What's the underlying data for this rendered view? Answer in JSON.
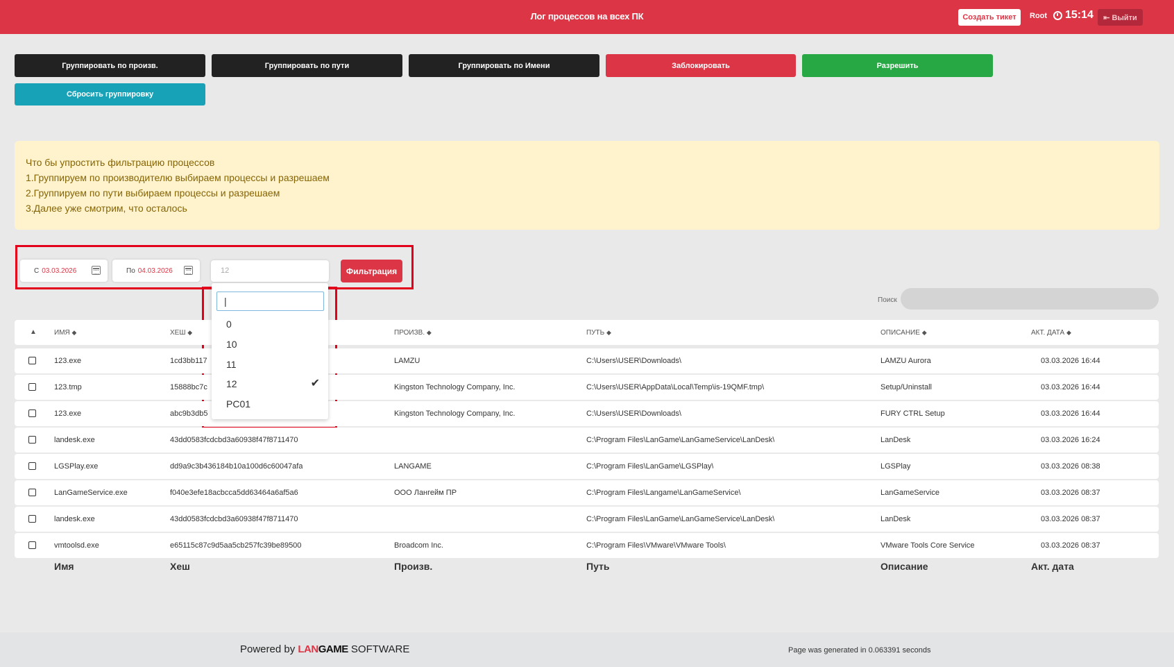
{
  "header": {
    "title": "Лог процессов на всех ПК",
    "create_ticket": "Создать тикет",
    "user": "Root",
    "time": "15:14",
    "logout": "Выйти"
  },
  "actions": {
    "group_by_vendor": "Группировать по произв.",
    "group_by_path": "Группировать по пути",
    "group_by_name": "Группировать по Имени",
    "block": "Заблокировать",
    "allow": "Разрешить",
    "reset_grouping": "Сбросить группировку"
  },
  "info": {
    "lines": [
      "Что бы упростить фильтрацию процессов",
      "1.Группируем по производителю выбираем процессы и разрешаем",
      "2.Группируем по пути выбираем процессы и разрешаем",
      "3.Далее уже смотрим, что осталось"
    ]
  },
  "filter": {
    "from_label": "С",
    "from_value": "03.03.2026",
    "to_label": "По",
    "to_value": "04.03.2026",
    "pc_selected": "12",
    "button": "Фильтрация",
    "dropdown_search": "|",
    "options": [
      "0",
      "10",
      "11",
      "12",
      "PC01"
    ],
    "checked_option": "12",
    "check_mark": "✔"
  },
  "search": {
    "label": "Поиск"
  },
  "table": {
    "header_sort": "▲",
    "sort_glyph": "◆",
    "columns": [
      "ИМЯ",
      "ХЕШ",
      "ПРОИЗВ.",
      "ПУТЬ",
      "ОПИСАНИЕ",
      "АКТ. ДАТА"
    ],
    "rows": [
      {
        "name": "123.exe",
        "hash": "1cd3bb117",
        "vendor": "LAMZU",
        "path": "C:\\Users\\USER\\Downloads\\",
        "desc": "LAMZU Aurora",
        "date": "03.03.2026 16:44"
      },
      {
        "name": "123.tmp",
        "hash": "15888bc7c",
        "vendor": "Kingston Technology Company, Inc.",
        "path": "C:\\Users\\USER\\AppData\\Local\\Temp\\is-19QMF.tmp\\",
        "desc": "Setup/Uninstall",
        "date": "03.03.2026 16:44"
      },
      {
        "name": "123.exe",
        "hash": "abc9b3db5",
        "vendor": "Kingston Technology Company, Inc.",
        "path": "C:\\Users\\USER\\Downloads\\",
        "desc": "FURY CTRL Setup",
        "date": "03.03.2026 16:44"
      },
      {
        "name": "landesk.exe",
        "hash": "43dd0583fcdcbd3a60938f47f8711470",
        "vendor": "",
        "path": "C:\\Program Files\\LanGame\\LanGameService\\LanDesk\\",
        "desc": "LanDesk",
        "date": "03.03.2026 16:24"
      },
      {
        "name": "LGSPlay.exe",
        "hash": "dd9a9c3b436184b10a100d6c60047afa",
        "vendor": "LANGAME",
        "path": "C:\\Program Files\\LanGame\\LGSPlay\\",
        "desc": "LGSPlay",
        "date": "03.03.2026 08:38"
      },
      {
        "name": "LanGameService.exe",
        "hash": "f040e3efe18acbcca5dd63464a6af5a6",
        "vendor": "ООО Лангейм ПР",
        "path": "C:\\Program Files\\Langame\\LanGameService\\",
        "desc": "LanGameService",
        "date": "03.03.2026 08:37"
      },
      {
        "name": "landesk.exe",
        "hash": "43dd0583fcdcbd3a60938f47f8711470",
        "vendor": "",
        "path": "C:\\Program Files\\LanGame\\LanGameService\\LanDesk\\",
        "desc": "LanDesk",
        "date": "03.03.2026 08:37"
      },
      {
        "name": "vmtoolsd.exe",
        "hash": "e65115c87c9d5aa5cb257fc39be89500",
        "vendor": "Broadcom Inc.",
        "path": "C:\\Program Files\\VMware\\VMware Tools\\",
        "desc": "VMware Tools Core Service",
        "date": "03.03.2026 08:37"
      }
    ],
    "footer": [
      "Имя",
      "Хеш",
      "Произв.",
      "Путь",
      "Описание",
      "Акт. дата"
    ]
  },
  "footer": {
    "powered": "Powered by",
    "brand_1": "LAN",
    "brand_2": "GAME",
    "brand_3": "SOFTWARE",
    "generated": "Page was generated in 0.063391 seconds"
  }
}
